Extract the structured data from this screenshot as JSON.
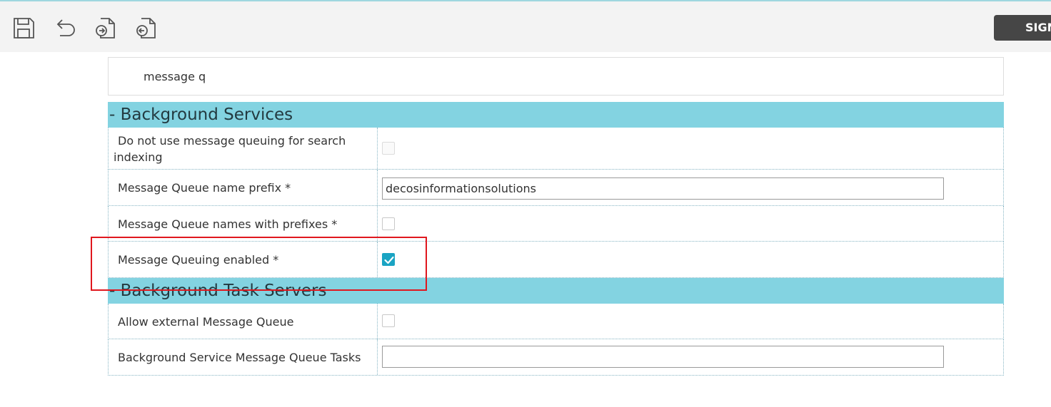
{
  "toolbar": {
    "icons": [
      "save-icon",
      "undo-icon",
      "export-icon",
      "import-icon"
    ],
    "sign_button_label": "SIGN"
  },
  "search": {
    "value": "message q"
  },
  "sections": [
    {
      "title": "- Background Services",
      "rows": [
        {
          "label": "Do not use message queuing for search indexing",
          "control": "checkbox",
          "checked": false,
          "disabled": true
        },
        {
          "label": "Message Queue name prefix *",
          "control": "text",
          "value": "decosinformationsolutions"
        },
        {
          "label": "Message Queue names with prefixes *",
          "control": "checkbox",
          "checked": false
        },
        {
          "label": "Message Queuing enabled *",
          "control": "checkbox",
          "checked": true
        }
      ]
    },
    {
      "title": "- Background Task Servers",
      "rows": [
        {
          "label": "Allow external Message Queue",
          "control": "checkbox",
          "checked": false
        },
        {
          "label": "Background Service Message Queue Tasks",
          "control": "text",
          "value": ""
        }
      ]
    }
  ],
  "colors": {
    "section_header": "#83d3e1",
    "checkbox_checked": "#1aa4c3",
    "highlight": "#e0171e",
    "sign_button": "#464646"
  }
}
